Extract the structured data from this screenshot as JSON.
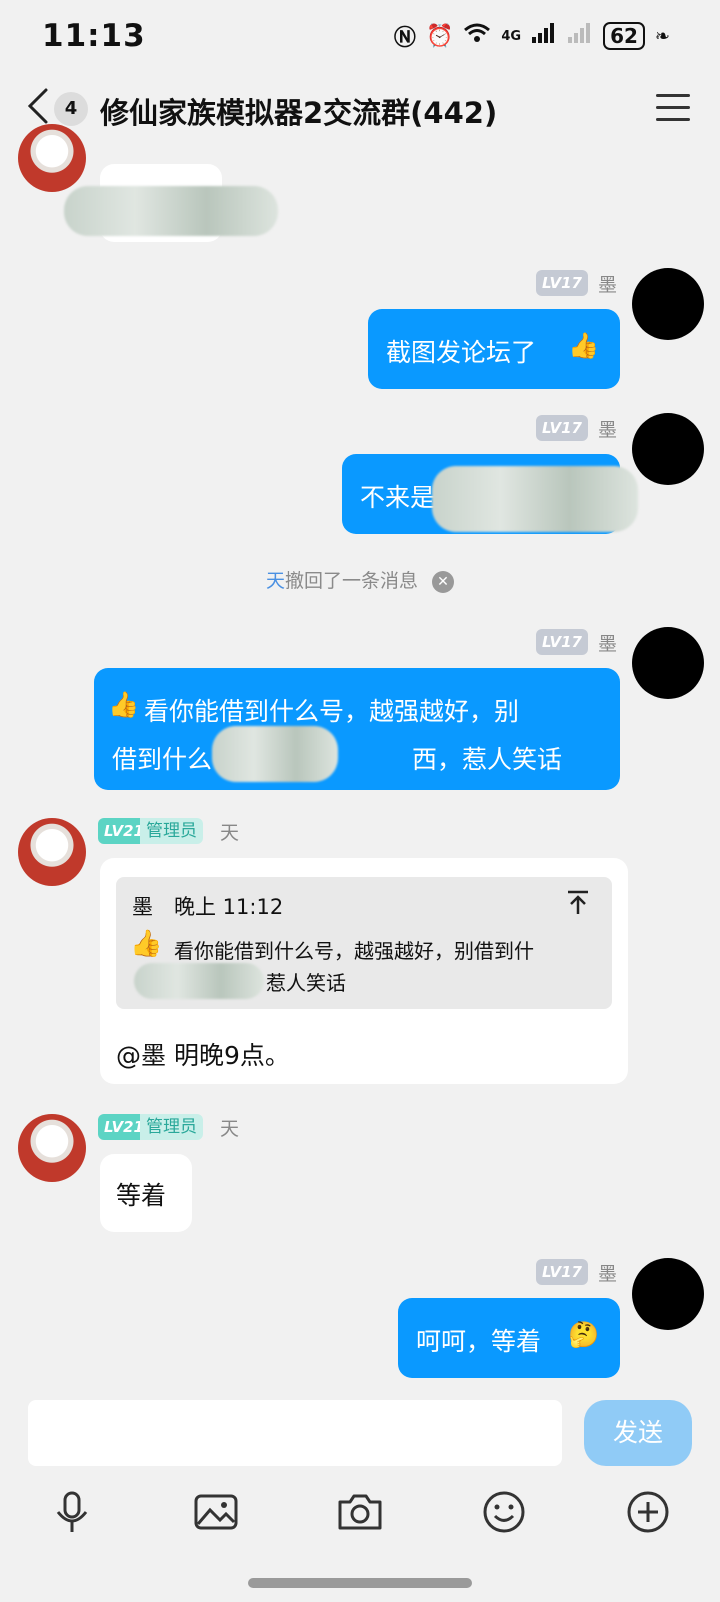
{
  "status": {
    "time": "11:13",
    "net": "4G",
    "battery": "62"
  },
  "header": {
    "back_count": "4",
    "title": "修仙家族模拟器2交流群(442)"
  },
  "messages": {
    "m1": {
      "text": "截图发论坛了",
      "name": "墨",
      "level": "LV17"
    },
    "m2": {
      "text": "不来是",
      "name": "墨",
      "level": "LV17"
    },
    "recall": {
      "name": "天",
      "text": "撤回了一条消息"
    },
    "m3": {
      "line1": "看你能借到什么号，越强越好，别",
      "line2a": "借到什么",
      "line2b": "西，惹人笑话",
      "name": "墨",
      "level": "LV17"
    },
    "m4": {
      "level": "LV21",
      "role": "管理员",
      "name": "天",
      "quote_name": "墨",
      "quote_time": "晚上 11:12",
      "quote_line1": "看你能借到什么号，越强越好，别借到什",
      "quote_line2": "惹人笑话",
      "text": "@墨  明晚9点。"
    },
    "m5": {
      "level": "LV21",
      "role": "管理员",
      "name": "天",
      "text": "等着"
    },
    "m6": {
      "text": "呵呵，等着",
      "name": "墨",
      "level": "LV17"
    }
  },
  "composer": {
    "send_label": "发送"
  }
}
